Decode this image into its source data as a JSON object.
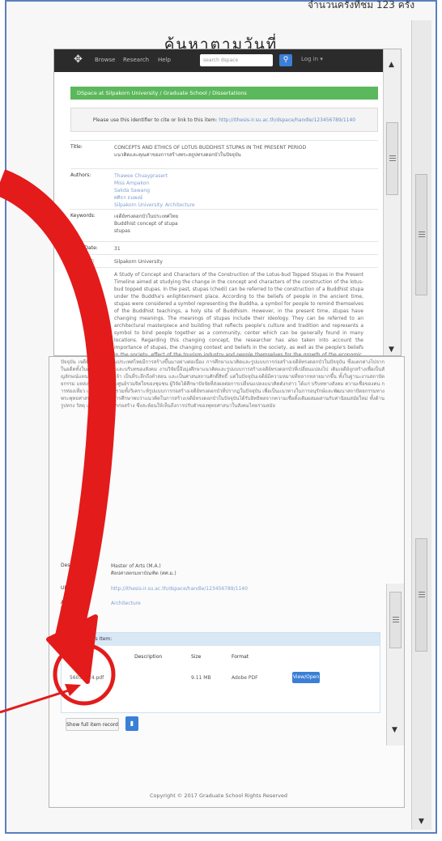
{
  "header": {
    "visit_count": "จำนวนครั้งที่ชม 123 ครั้ง",
    "title": "ค้นหาตามวันที่"
  },
  "navbar": {
    "logo_icon": "grid-logo-icon",
    "links": [
      "Browse",
      "Research",
      "Help"
    ],
    "search_placeholder": "search dspace",
    "search_icon": "search-icon",
    "user_label": "Log in ▾"
  },
  "breadcrumb": "DSpace at Silpakorn University  /  Graduate School  /  Dissertations",
  "alert": {
    "text": "Please use this identifier to cite or link to this item:",
    "link": "http://ithesis-ir.su.ac.th/dspace/handle/123456789/1140"
  },
  "meta": {
    "title_label": "Title:",
    "title_lines": [
      "CONCEPTS AND ETHICS OF LOTUS BUDDHIST STUPAS IN THE PRESENT PERIOD",
      "แนวคิดและคุณค่าของการสร้างพระสถูปทรงดอกบัวในปัจจุบัน"
    ],
    "authors_label": "Authors:",
    "authors": [
      "Thawee Chuayprasert",
      "Miss Ampakon",
      "Sakda Sawang",
      "ศศิธร ธนพงษ์",
      "Silpakorn University. Architecture"
    ],
    "keywords_label": "Keywords:",
    "keywords": [
      "เจดีย์ทรงดอกบัวในประเทศไทย",
      "Buddhist concept of stupa",
      "stupas"
    ],
    "issue_label": "Issue Date:",
    "issue_value": "31",
    "publisher_label": "Publisher:",
    "publisher_value": "Silpakorn University",
    "abstract_label": "Abstract:",
    "abstract_text": "A Study of Concept and Characters of the Construction of the Lotus-bud Topped Stupas in the Present Timeline aimed at studying the change in the concept and characters of the construction of the lotus-bud topped stupas. In the past, stupas (chedi) can be referred to the construction of a Buddhist stupa under the Buddha's enlightenment place. According to the beliefs of people in the ancient time, stupas were considered a symbol representing the Buddha, a symbol for people to remind themselves of the Buddhist teachings, a holy site of Buddhism. However, in the present time, stupas have changing meanings. The meanings of stupas include their ideology. They can be referred to an architectural masterpiece and building that reflects people's culture and tradition and represents a symbol to bind people together as a community, center which can be generally found in many locations. Regarding this changing concept, the researcher has also taken into account the importance of stupas, the changing context and beliefs in the society, as well as the people's beliefs in the society, effect of the tourism industry and people themselves for the growth of the economic. The study covers both the concept behind and the characters of the construction of the lotus-bud topped stupas."
  },
  "lower": {
    "thai_abstract": "ปัจจุบัน เจดีย์ทรงดอกบัวในประเทศไทยมีการสร้างขึ้นมาอย่างต่อเนื่อง การศึกษาแนวคิดและรูปแบบการก่อสร้างเจดีย์ทรงดอกบัวในปัจจุบัน ซึ่งแตกต่างไปจากในอดีตทั้งในด้านความเชื่อและบริบทของสังคม งานวิจัยนี้จึงมุ่งศึกษาแนวคิดและรูปแบบการสร้างเจดีย์ทรงดอกบัวที่เปลี่ยนแปลงไป เดิมเจดีย์ถูกสร้างเพื่อเป็นสัญลักษณ์แทนองค์พระพุทธเจ้า เป็นที่ระลึกถึงคำสอน และเป็นศาสนสถานศักดิ์สิทธิ์ แต่ในปัจจุบันเจดีย์มีความหมายที่หลากหลายมากขึ้น ทั้งในฐานะงานสถาปัตยกรรม แหล่งท่องเที่ยว และศูนย์รวมจิตใจของชุมชน ผู้วิจัยได้ศึกษาปัจจัยที่ส่งผลต่อการเปลี่ยนแปลงแนวคิดดังกล่าว ได้แก่ บริบททางสังคม ความเชื่อของคน การท่องเที่ยว และเศรษฐกิจ รวมทั้งวิเคราะห์รูปแบบการก่อสร้างเจดีย์ทรงดอกบัวที่ปรากฏในปัจจุบัน เพื่อเป็นแนวทางในการอนุรักษ์และพัฒนาสถาปัตยกรรมทางพระพุทธศาสนาต่อไป ผลการศึกษาพบว่าแนวคิดในการสร้างเจดีย์ทรงดอกบัวในปัจจุบันได้รับอิทธิพลจากความเชื่อดั้งเดิมผสมผสานกับค่านิยมสมัยใหม่ ทั้งด้านรูปทรง วัสดุ และเทคนิคการก่อสร้าง ซึ่งสะท้อนให้เห็นถึงการปรับตัวของพุทธศาสนาในสังคมไทยร่วมสมัย",
    "degree_label": "Description:",
    "degree_lines": [
      "Master of Arts (M.A.)",
      "ศิลปศาสตรมหาบัณฑิต (ศศ.ม.)"
    ],
    "uri_label": "URI:",
    "uri_value": "http://ithesis-ir.su.ac.th/dspace/handle/123456789/1140",
    "collection_label": "Appears in Collections:",
    "collection_value": "Architecture"
  },
  "files": {
    "panel_title": "Files in This Item:",
    "col_file": "File",
    "col_desc": "Description",
    "col_size": "Size",
    "col_format": "Format",
    "file_name": "56057324.pdf",
    "file_size": "9.11 MB",
    "file_format": "Adobe PDF",
    "view_button": "View/Open",
    "show_record": "Show full item record",
    "stats_icon": "bar-chart-icon"
  },
  "footer": {
    "copyright": "Copyright © 2017 Graduate School Rights Reserved"
  },
  "annotation": {
    "color": "#e31b1b",
    "arrow_icon": "red-arrow-icon",
    "circle_icon": "red-circle-highlight-icon"
  }
}
